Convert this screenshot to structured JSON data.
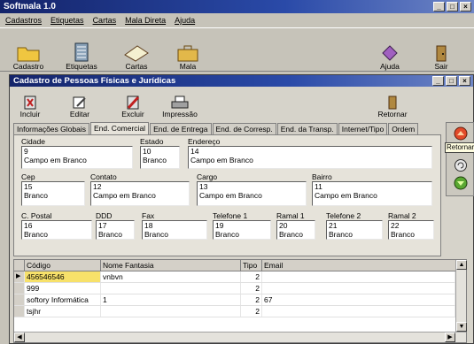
{
  "app": {
    "title": "Softmala 1.0",
    "menu": [
      "Cadastros",
      "Etiquetas",
      "Cartas",
      "Mala Direta",
      "Ajuda"
    ],
    "toolbar": [
      {
        "label": "Cadastro",
        "icon": "folder-icon"
      },
      {
        "label": "Etiquetas",
        "icon": "labels-icon"
      },
      {
        "label": "Cartas",
        "icon": "envelope-icon"
      },
      {
        "label": "Mala",
        "icon": "bag-icon"
      },
      {
        "label": "Ajuda",
        "icon": "help-book-icon"
      },
      {
        "label": "Sair",
        "icon": "exit-door-icon"
      }
    ]
  },
  "child": {
    "title": "Cadastro de Pessoas Físicas e Jurídicas",
    "toolbar": [
      {
        "label": "Incluir",
        "icon": "add-record-icon"
      },
      {
        "label": "Editar",
        "icon": "edit-pencil-icon"
      },
      {
        "label": "Excluir",
        "icon": "delete-record-icon"
      },
      {
        "label": "Impressão",
        "icon": "printer-icon"
      },
      {
        "label": "Retornar",
        "icon": "return-door-icon"
      }
    ],
    "tabs": [
      "Informações Globais",
      "End. Comercial",
      "End. de Entrega",
      "End. de Corresp.",
      "End. da Transp.",
      "Internet/Tipo",
      "Ordem"
    ],
    "active_tab": "End. Comercial",
    "side_tooltip": "Retornar",
    "fields": {
      "cidade": {
        "label": "Cidade",
        "num": "9",
        "value": "Campo em Branco"
      },
      "estado": {
        "label": "Estado",
        "num": "10",
        "value": "Branco"
      },
      "endereco": {
        "label": "Endereço",
        "num": "14",
        "value": "Campo em Branco"
      },
      "cep": {
        "label": "Cep",
        "num": "15",
        "value": "Branco"
      },
      "contato": {
        "label": "Contato",
        "num": "12",
        "value": "Campo em Branco"
      },
      "cargo": {
        "label": "Cargo",
        "num": "13",
        "value": "Campo em Branco"
      },
      "bairro": {
        "label": "Bairro",
        "num": "11",
        "value": "Campo em Branco"
      },
      "cpostal": {
        "label": "C. Postal",
        "num": "16",
        "value": "Branco"
      },
      "ddd": {
        "label": "DDD",
        "num": "17",
        "value": "Branco"
      },
      "fax": {
        "label": "Fax",
        "num": "18",
        "value": "Branco"
      },
      "telefone1": {
        "label": "Telefone 1",
        "num": "19",
        "value": "Branco"
      },
      "ramal1": {
        "label": "Ramal 1",
        "num": "20",
        "value": "Branco"
      },
      "telefone2": {
        "label": "Telefone 2",
        "num": "21",
        "value": "Branco"
      },
      "ramal2": {
        "label": "Ramal 2",
        "num": "22",
        "value": "Branco"
      }
    },
    "grid": {
      "columns": [
        "Código",
        "Nome Fantasia",
        "Tipo",
        "Email"
      ],
      "rows": [
        [
          "456546546",
          "vnbvn",
          "2",
          ""
        ],
        [
          "999",
          "",
          "2",
          ""
        ],
        [
          "softory Informática",
          "1",
          "2",
          "67"
        ],
        [
          "tsjhr",
          "",
          "2",
          ""
        ]
      ]
    }
  }
}
